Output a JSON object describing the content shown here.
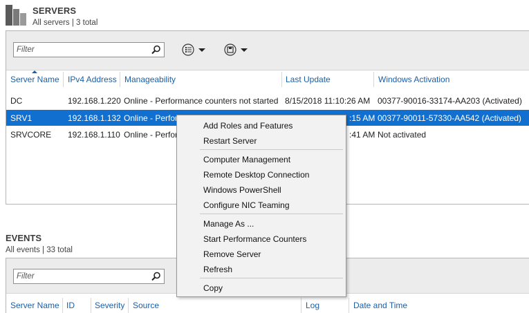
{
  "servers": {
    "title": "SERVERS",
    "subtitle": "All servers | 3 total",
    "filter_placeholder": "Filter",
    "columns": [
      "Server Name",
      "IPv4 Address",
      "Manageability",
      "Last Update",
      "Windows Activation"
    ],
    "rows": [
      {
        "name": "DC",
        "ip": "192.168.1.220",
        "manageability": "Online - Performance counters not started",
        "last_update": "8/15/2018 11:10:26 AM",
        "activation": "00377-90016-33174-AA203 (Activated)",
        "selected": false
      },
      {
        "name": "SRV1",
        "ip": "192.168.1.132",
        "manageability": "Online - Perfor",
        "last_update": ":15 AM",
        "activation": "00377-90011-57330-AA542 (Activated)",
        "selected": true
      },
      {
        "name": "SRVCORE",
        "ip": "192.168.1.110",
        "manageability": "Online - Perfor",
        "last_update": ":41 AM",
        "activation": "Not activated",
        "selected": false
      }
    ]
  },
  "events": {
    "title": "EVENTS",
    "subtitle": "All events | 33 total",
    "filter_placeholder": "Filter",
    "columns": [
      "Server Name",
      "ID",
      "Severity",
      "Source",
      "Log",
      "Date and Time"
    ]
  },
  "context_menu": {
    "items": [
      "Add Roles and Features",
      "Restart Server",
      "Computer Management",
      "Remote Desktop Connection",
      "Windows PowerShell",
      "Configure NIC Teaming",
      "Manage As ...",
      "Start Performance Counters",
      "Remove Server",
      "Refresh",
      "Copy"
    ]
  },
  "icons": {
    "tile": "servers-tile-icon",
    "search": "search-icon",
    "view": "list-view-icon",
    "save": "save-icon",
    "dropdown": "chevron-down-icon"
  },
  "colors": {
    "accent": "#1170cf",
    "header_text": "#1a5fa6",
    "toolbar_bg": "#ececec"
  }
}
